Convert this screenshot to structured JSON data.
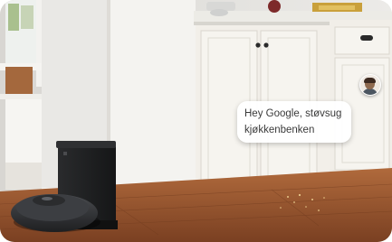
{
  "image": {
    "alt": "Robot vacuum with auto-empty dock in a kitchen next to white cabinets",
    "speech_bubble": {
      "line1": "Hey Google, støvsug",
      "line2": "kjøkkenbenken"
    },
    "avatar": {
      "icon": "user-avatar-icon"
    },
    "colors": {
      "cabinet": "#f2efe9",
      "floor": "#9b5a32",
      "robot": "#2b2c2e",
      "wall": "#dcdad6"
    }
  }
}
